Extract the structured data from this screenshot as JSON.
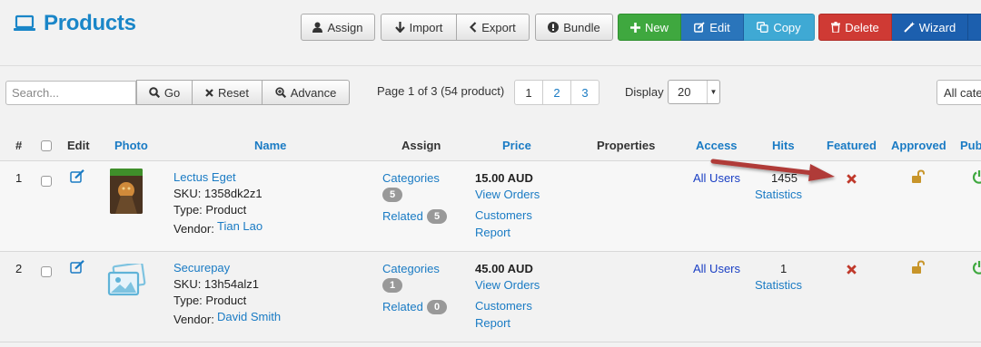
{
  "header": {
    "title": "Products"
  },
  "toolbar": {
    "assign": "Assign",
    "import": "Import",
    "export": "Export",
    "bundle": "Bundle",
    "new": "New",
    "edit": "Edit",
    "copy": "Copy",
    "delete": "Delete",
    "wizard": "Wizard"
  },
  "filters": {
    "search_placeholder": "Search...",
    "go": "Go",
    "reset": "Reset",
    "advance": "Advance",
    "page_info": "Page 1 of 3 (54 product)",
    "pages": [
      "1",
      "2",
      "3"
    ],
    "display_label": "Display",
    "display_value": "20",
    "category_value": "All categories"
  },
  "table": {
    "headers": {
      "num": "#",
      "edit": "Edit",
      "photo": "Photo",
      "name": "Name",
      "assign": "Assign",
      "price": "Price",
      "properties": "Properties",
      "access": "Access",
      "hits": "Hits",
      "featured": "Featured",
      "approved": "Approved",
      "published": "Published"
    },
    "rows": [
      {
        "num": "1",
        "name": "Lectus Eget",
        "sku": "SKU: 1358dk2z1",
        "type": "Type: Product",
        "vendor_label": "Vendor:",
        "vendor": "Tian Lao",
        "categories_label": "Categories",
        "categories_count": "5",
        "related_label": "Related",
        "related_count": "5",
        "price": "15.00 AUD",
        "view_orders": "View Orders",
        "customers_report": "Customers Report",
        "customers": "Customers",
        "report": "Report",
        "access": "All Users",
        "hits": "1455",
        "statistics": "Statistics"
      },
      {
        "num": "2",
        "name": "Securepay",
        "sku": "SKU: 13h54alz1",
        "type": "Type: Product",
        "vendor_label": "Vendor:",
        "vendor": "David Smith",
        "categories_label": "Categories",
        "categories_count": "1",
        "related_label": "Related",
        "related_count": "0",
        "price": "45.00 AUD",
        "view_orders": "View Orders",
        "customers": "Customers",
        "report": "Report",
        "access": "All Users",
        "hits": "1",
        "statistics": "Statistics"
      }
    ]
  },
  "colors": {
    "link": "#1a7bc4",
    "title": "#1a86c8",
    "featured_off": "#c0392b",
    "approved_lock": "#c8952a",
    "published_on": "#3fa83f",
    "annotation_arrow": "#b03a38"
  }
}
